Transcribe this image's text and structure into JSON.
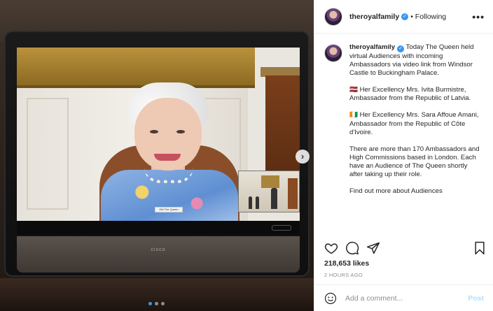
{
  "media": {
    "nameplate": "HM The Queen",
    "monitor_brand": "cisco",
    "carousel": {
      "total": 3,
      "active": 1
    }
  },
  "post": {
    "username": "theroyalfamily",
    "following_label": "• Following",
    "more_label": "•••",
    "caption": {
      "username": "theroyalfamily",
      "paragraphs": [
        "Today The Queen held virtual Audiences with incoming Ambassadors via video link from Windsor Castle to Buckingham Palace.",
        "🇱🇻 Her Excellency Mrs. Ivita Burmistre, Ambassador from the Republic of Latvia.",
        "🇨🇮 Her Excellency Mrs. Sara Affoue Amani, Ambassador from the Republic of Côte d'Ivoire.",
        "There are more than 170 Ambassadors and High Commissions based in London. Each have an Audience of The Queen shortly after taking up their role.",
        "Find out more about Audiences"
      ]
    },
    "likes": "218,653 likes",
    "time": "2 HOURS AGO",
    "comment_placeholder": "Add a comment...",
    "post_label": "Post",
    "colors": {
      "verified": "#3897f0",
      "post_disabled": "#b2dffc"
    }
  }
}
